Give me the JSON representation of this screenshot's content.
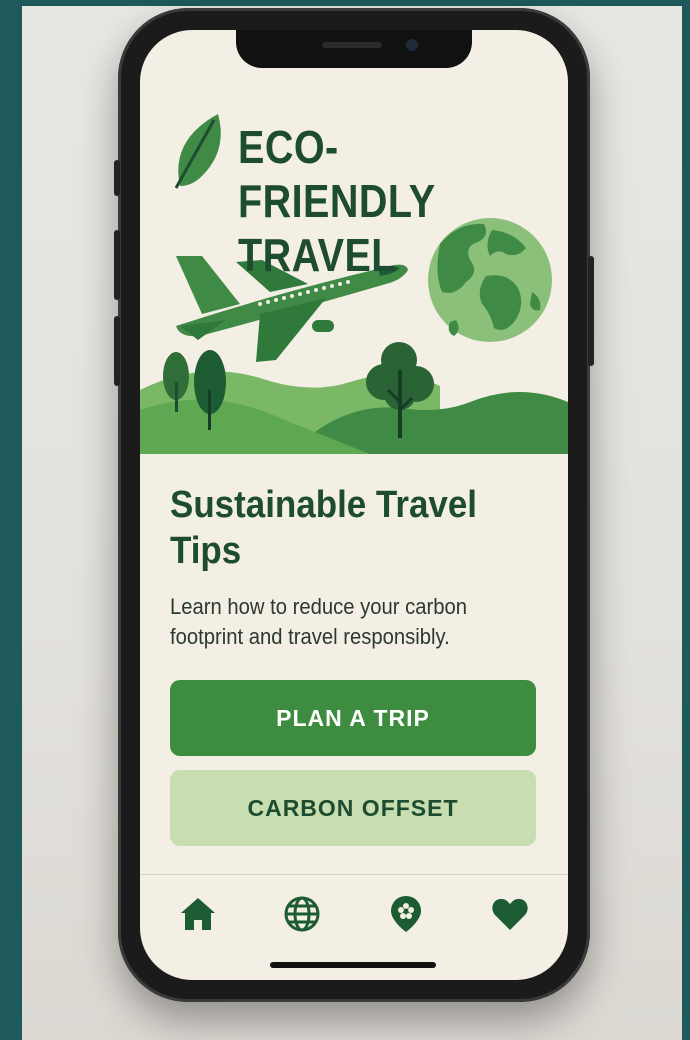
{
  "app": {
    "title_line1": "ECO-FRIENDLY",
    "title_line2": "TRAVEL"
  },
  "content": {
    "heading": "Sustainable Travel Tips",
    "description": "Learn how to reduce your carbon footprint and travel responsibly."
  },
  "actions": {
    "primary_label": "PLAN A TRIP",
    "secondary_label": "CARBON OFFSET"
  },
  "nav": {
    "items": [
      {
        "icon": "home-icon"
      },
      {
        "icon": "globe-icon"
      },
      {
        "icon": "location-pin-icon"
      },
      {
        "icon": "heart-icon"
      }
    ]
  },
  "colors": {
    "primary_green": "#3d8c40",
    "dark_green": "#1d4c30",
    "light_green": "#c8ddb0",
    "background": "#f4efe5"
  }
}
